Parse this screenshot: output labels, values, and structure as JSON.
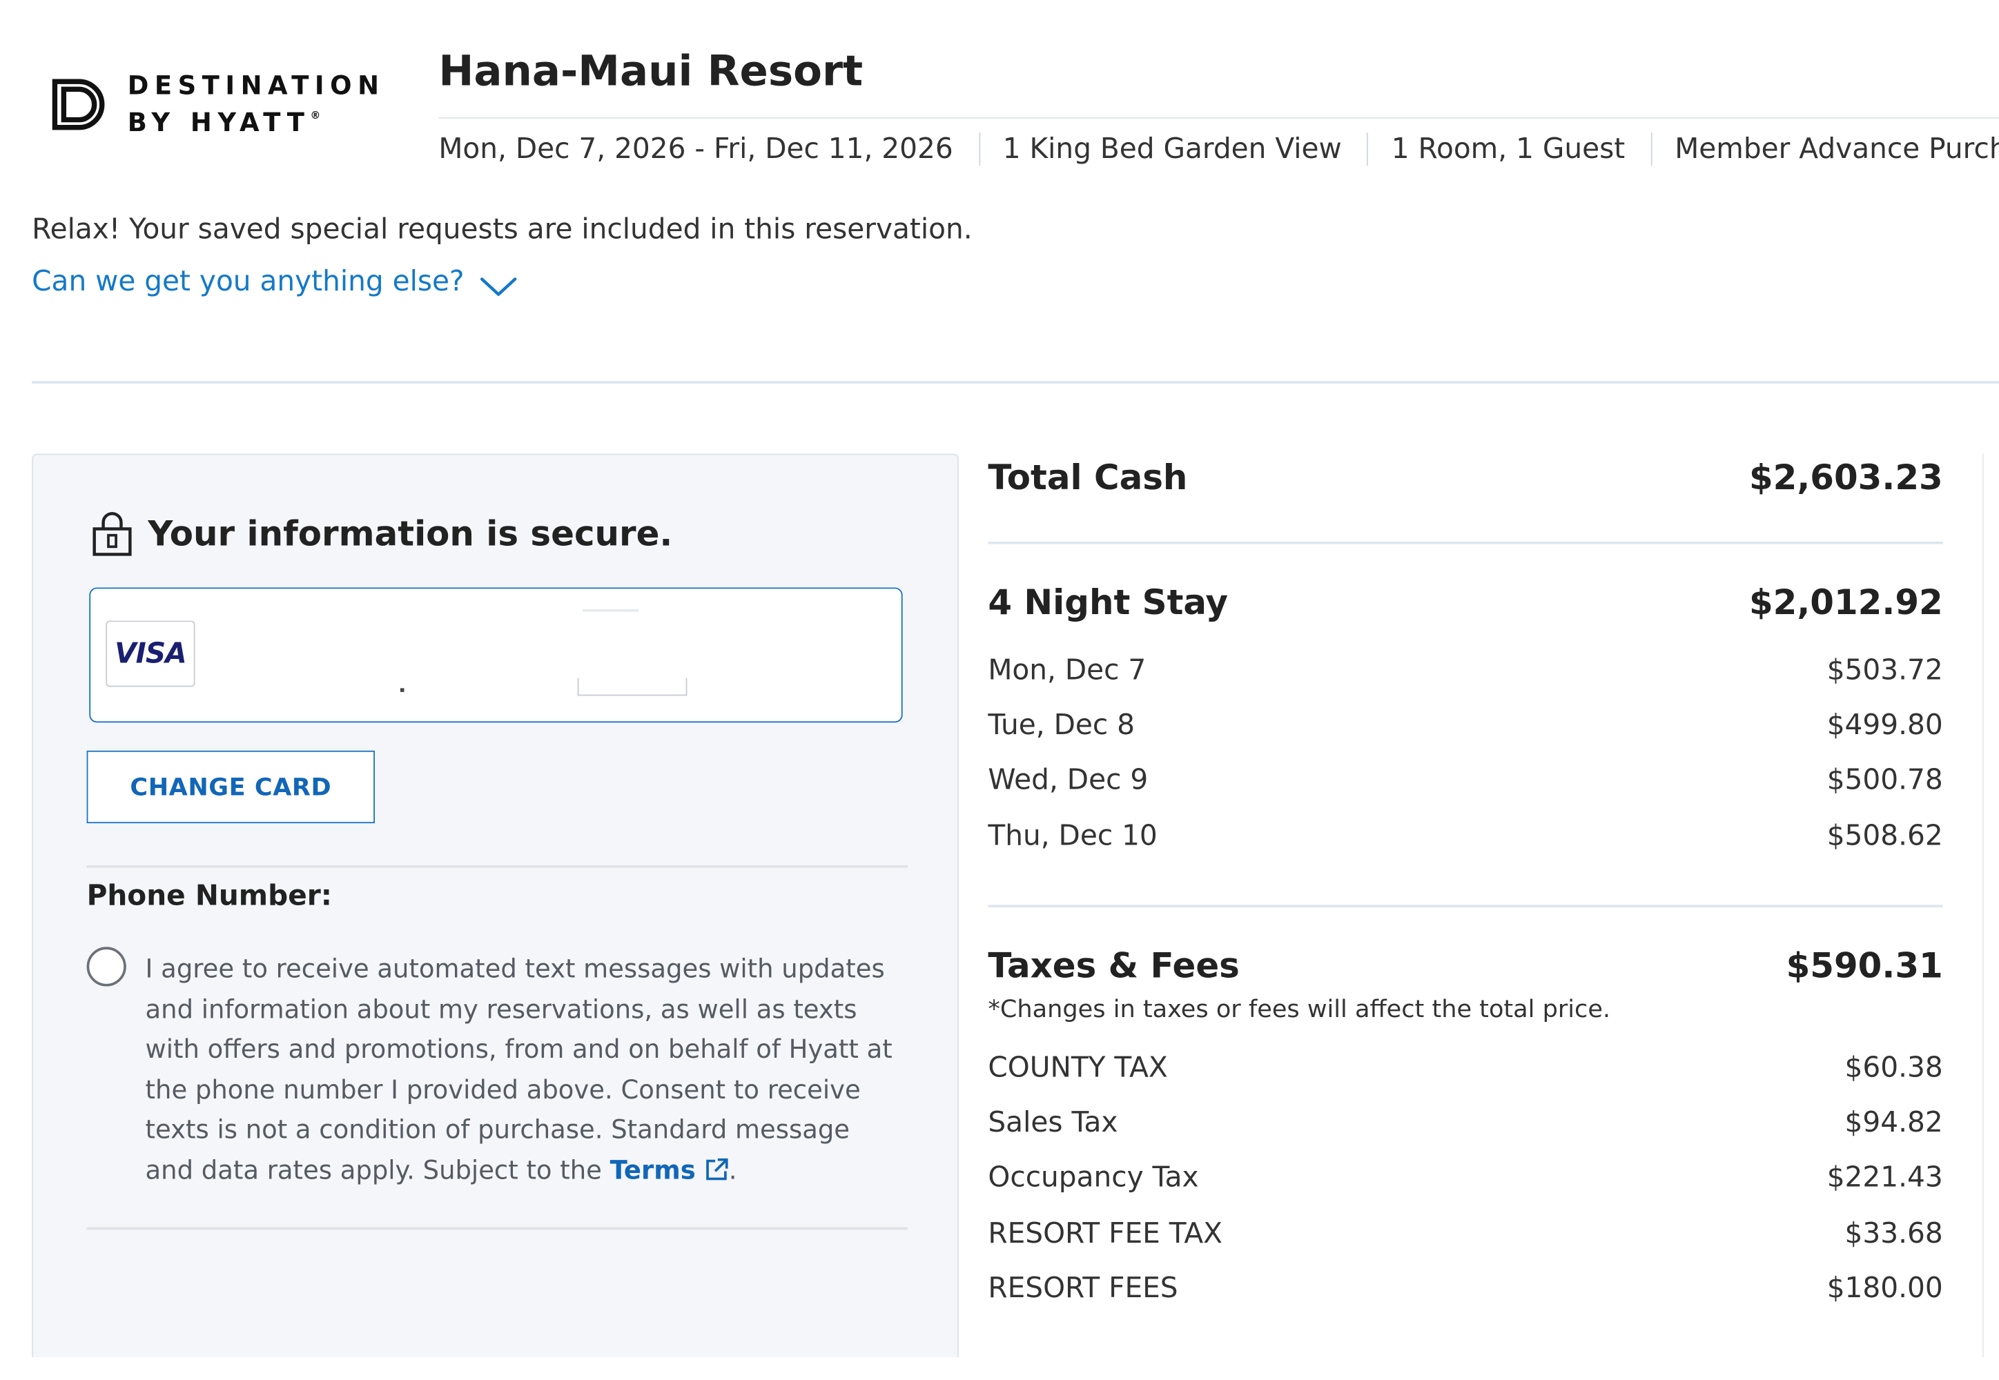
{
  "brand": {
    "line1": "DESTINATION",
    "line2": "BY HYATT",
    "registered": "®"
  },
  "header": {
    "hotel_name": "Hana-Maui Resort",
    "dates": "Mon, Dec 7, 2026 - Fri, Dec 11, 2026",
    "room_type": "1 King Bed Garden View",
    "occupancy": "1 Room, 1 Guest",
    "rate": "Member Advance Purchase"
  },
  "requests": {
    "note": "Relax! Your saved special requests are included in this reservation.",
    "link": "Can we get you anything else?"
  },
  "payment": {
    "secure_title": "Your information is secure.",
    "card_brand": "VISA",
    "change_card_label": "CHANGE CARD",
    "phone_label": "Phone Number:",
    "consent_text": "I agree to receive automated text messages with updates and information about my reservations, as well as texts with offers and promotions, from and on behalf of Hyatt at the phone number I provided above. Consent to receive texts is not a condition of purchase. Standard message and data rates apply. Subject to the",
    "terms_label": "Terms",
    "consent_end": "."
  },
  "summary": {
    "total_label": "Total Cash",
    "total_value": "$2,603.23",
    "stay_label": "4 Night Stay",
    "stay_value": "$2,012.92",
    "nights": [
      {
        "label": "Mon, Dec 7",
        "value": "$503.72"
      },
      {
        "label": "Tue, Dec 8",
        "value": "$499.80"
      },
      {
        "label": "Wed, Dec 9",
        "value": "$500.78"
      },
      {
        "label": "Thu, Dec 10",
        "value": "$508.62"
      }
    ],
    "taxes_label": "Taxes & Fees",
    "taxes_value": "$590.31",
    "taxes_note": "*Changes in taxes or fees will affect the total price.",
    "taxes": [
      {
        "label": "COUNTY TAX",
        "value": "$60.38"
      },
      {
        "label": "Sales Tax",
        "value": "$94.82"
      },
      {
        "label": "Occupancy Tax",
        "value": "$221.43"
      },
      {
        "label": "RESORT FEE TAX",
        "value": "$33.68"
      },
      {
        "label": "RESORT FEES",
        "value": "$180.00"
      }
    ]
  },
  "colors": {
    "link": "#1479c9",
    "button_border": "#1b74c5",
    "panel_bg": "#f4f6f9",
    "visa": "#1a1f71"
  }
}
